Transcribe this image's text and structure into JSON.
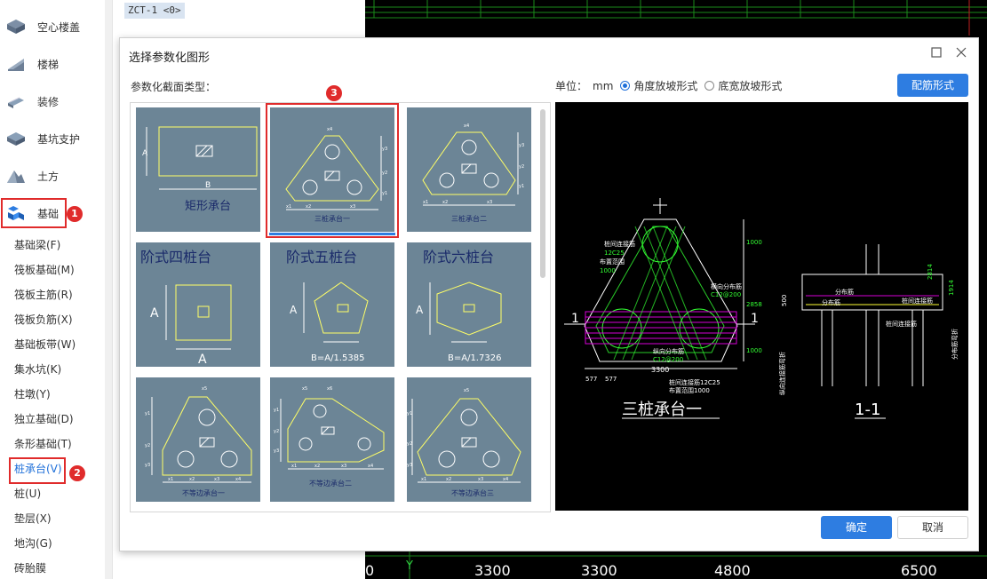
{
  "sidebar": {
    "categories": [
      {
        "label": "空心楼盖",
        "icon": "hollow-floor-icon"
      },
      {
        "label": "楼梯",
        "icon": "stairs-icon"
      },
      {
        "label": "装修",
        "icon": "decoration-icon"
      },
      {
        "label": "基坑支护",
        "icon": "pit-support-icon"
      },
      {
        "label": "土方",
        "icon": "earthwork-icon"
      },
      {
        "label": "基础",
        "icon": "foundation-icon"
      }
    ],
    "sub_items": [
      "基础梁(F)",
      "筏板基础(M)",
      "筏板主筋(R)",
      "筏板负筋(X)",
      "基础板带(W)",
      "集水坑(K)",
      "柱墩(Y)",
      "独立基础(D)",
      "条形基础(T)",
      "桩承台(V)",
      "桩(U)",
      "垫层(X)",
      "地沟(G)",
      "砖胎膜"
    ],
    "selected_sub": "桩承台(V)"
  },
  "badges": [
    "1",
    "2",
    "3"
  ],
  "component_tag": "ZCT-1 <0>",
  "dialog": {
    "title": "选择参数化图形",
    "section_label": "参数化截面类型：",
    "unit_label": "单位：",
    "unit_value": "mm",
    "radio_options": [
      "角度放坡形式",
      "底宽放坡形式"
    ],
    "rebar_button": "配筋形式",
    "ok_button": "确定",
    "cancel_button": "取消",
    "thumbnails": [
      {
        "title": "矩形承台",
        "dims": [
          "A",
          "B"
        ]
      },
      {
        "title": "三桩承台一",
        "dims": [
          "x4",
          "y3",
          "y2",
          "y1",
          "x1",
          "x2",
          "x3"
        ]
      },
      {
        "title": "三桩承台二",
        "dims": [
          "x4",
          "y3",
          "y2",
          "y1",
          "x1",
          "x2",
          "x3"
        ]
      },
      {
        "title": "阶式四桩台",
        "dims": [
          "A",
          "A"
        ]
      },
      {
        "title": "阶式五桩台",
        "dims": [
          "A",
          "B=A/1.5385"
        ]
      },
      {
        "title": "阶式六桩台",
        "dims": [
          "A",
          "B=A/1.7326"
        ]
      },
      {
        "title": "不等边承台一",
        "dims": [
          "x5",
          "y1",
          "y2",
          "y3",
          "x1",
          "x2",
          "x3",
          "x4"
        ]
      },
      {
        "title": "不等边承台二",
        "dims": [
          "x5",
          "x6",
          "y1",
          "y2",
          "y3",
          "x1",
          "x2",
          "x3",
          "x4"
        ]
      },
      {
        "title": "不等边承台三",
        "dims": [
          "x5",
          "y1",
          "y2",
          "y3",
          "x1",
          "x2",
          "x3",
          "x4"
        ]
      }
    ],
    "preview": {
      "plan_title": "三桩承台一",
      "section_title": "1-1",
      "section_marks": [
        "1",
        "1"
      ],
      "dim_bottom": "3300",
      "dim_bottom_small": [
        "577",
        "577"
      ],
      "dim_right": [
        "1000",
        "2858",
        "1000"
      ],
      "labels_plan": [
        "桩间连接筋",
        "12C25",
        "布置范围",
        "1000",
        "横向分布筋",
        "C12@200",
        "纵向分布筋",
        "C12@200",
        "桩间连接筋12C25",
        "布置范围1000"
      ],
      "labels_section": [
        "分布筋",
        "分布筋",
        "桩间连接筋",
        "桩间连接筋",
        "纵向连接筋弯折",
        "分布筋弯折",
        "500",
        "1914",
        "2814"
      ]
    }
  },
  "cad_ruler": [
    "0",
    "3300",
    "3300",
    "4800",
    "6500"
  ],
  "cad_axis_label": "Y"
}
